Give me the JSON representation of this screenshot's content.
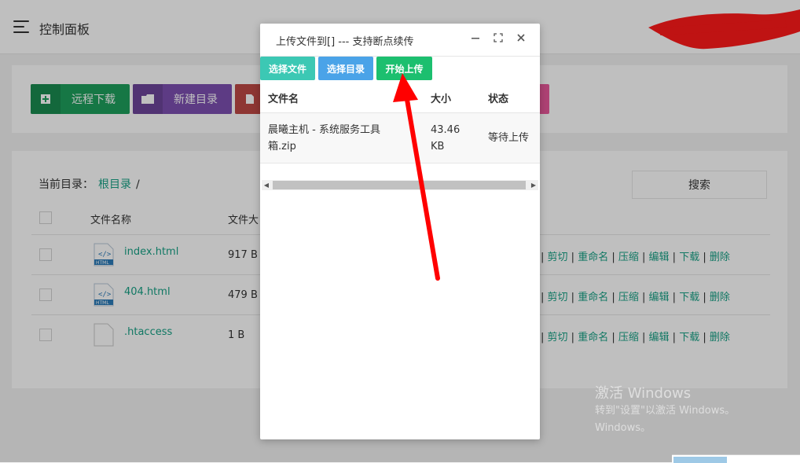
{
  "topbar": {
    "title": "控制面板",
    "menu_icon": "hamburger-menu-icon"
  },
  "toolbar": {
    "buttons": [
      {
        "label": "远程下载",
        "color": "#1e9f5c",
        "icon": "download-icon"
      },
      {
        "label": "新建目录",
        "color": "#7d4fb0",
        "icon": "folder-icon"
      },
      {
        "label": "",
        "color": "#d9534f",
        "icon": "file-icon"
      },
      {
        "label": "",
        "color": "#e8599b",
        "icon": ""
      }
    ]
  },
  "files": {
    "breadcrumb_label": "当前目录：",
    "breadcrumb_root": "根目录",
    "breadcrumb_sep": "/",
    "search_label": "搜索",
    "columns": {
      "name": "文件名称",
      "size": "文件大"
    },
    "rows": [
      {
        "name": "index.html",
        "size": "917 B",
        "icon": "html-file-icon"
      },
      {
        "name": "404.html",
        "size": "479 B",
        "icon": "html-file-icon"
      },
      {
        "name": ".htaccess",
        "size": "1 B",
        "icon": "blank-file-icon"
      }
    ],
    "actions": [
      "剪切",
      "重命名",
      "压缩",
      "编辑",
      "下载",
      "删除"
    ],
    "html_badge": "HTML"
  },
  "dialog": {
    "title": "上传文件到[] --- 支持断点续传",
    "buttons": {
      "choose_file": "选择文件",
      "choose_dir": "选择目录",
      "start_upload": "开始上传"
    },
    "table": {
      "headers": {
        "name": "文件名",
        "size": "大小",
        "status": "状态"
      },
      "row": {
        "name_line1": "晨曦主机 - 系统服务工具",
        "name_line2": "箱.zip",
        "size_line1": "43.46",
        "size_line2": "KB",
        "status": "等待上传"
      }
    },
    "scroll": {
      "left": "◀",
      "right": "▶"
    }
  },
  "watermark": {
    "line1": "激活 Windows",
    "line2": "转到\"设置\"以激活 Windows。",
    "line3": "Windows。"
  },
  "colors": {
    "accent": "#16a085",
    "btn_cyan": "#3cc8b4",
    "btn_blue": "#4aa3e8",
    "btn_green": "#1cbf6f",
    "annotation_arrow": "#ff0000"
  }
}
